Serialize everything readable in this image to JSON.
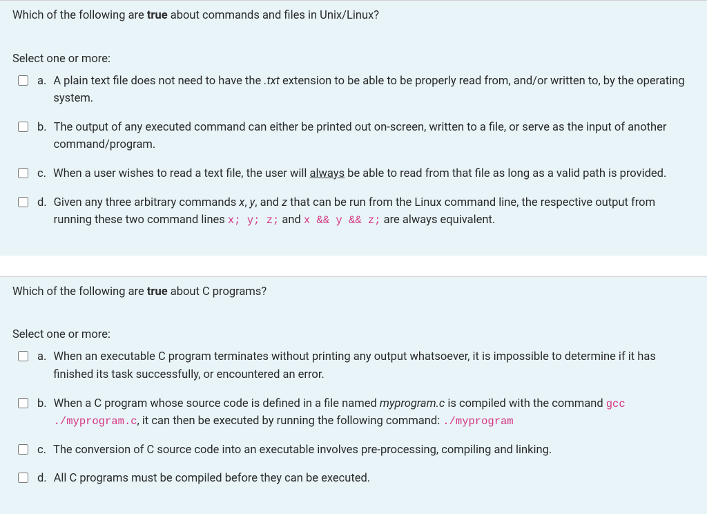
{
  "questions": [
    {
      "stem_parts": [
        {
          "t": "Which of the following are ",
          "cls": ""
        },
        {
          "t": "true",
          "cls": "strong"
        },
        {
          "t": " about commands and files in Unix/Linux?",
          "cls": ""
        }
      ],
      "select_label": "Select one or more:",
      "options": [
        {
          "letter": "a.",
          "parts": [
            {
              "t": "A plain text file does not need to have the ",
              "cls": ""
            },
            {
              "t": ".txt",
              "cls": "italic"
            },
            {
              "t": " extension to be able to be properly read from, and/or written to, by the operating system.",
              "cls": ""
            }
          ]
        },
        {
          "letter": "b.",
          "parts": [
            {
              "t": "The output of any executed command can either be printed out on-screen, written to a file, or serve as the input of another command/program.",
              "cls": ""
            }
          ]
        },
        {
          "letter": "c.",
          "parts": [
            {
              "t": "When a user wishes to read a text file, the user will ",
              "cls": ""
            },
            {
              "t": "always",
              "cls": "underline"
            },
            {
              "t": " be able to read from that file as long as a valid path is provided.",
              "cls": ""
            }
          ]
        },
        {
          "letter": "d.",
          "parts": [
            {
              "t": "Given any three arbitrary commands ",
              "cls": ""
            },
            {
              "t": "x",
              "cls": "italic"
            },
            {
              "t": ", ",
              "cls": ""
            },
            {
              "t": "y",
              "cls": "italic"
            },
            {
              "t": ", and ",
              "cls": ""
            },
            {
              "t": "z",
              "cls": "italic"
            },
            {
              "t": " that can be run from the Linux command line, the respective output from running these two command lines ",
              "cls": ""
            },
            {
              "t": "x; y; z;",
              "cls": "mono"
            },
            {
              "t": " and ",
              "cls": ""
            },
            {
              "t": "x && y && z;",
              "cls": "mono"
            },
            {
              "t": " are always equivalent.",
              "cls": ""
            }
          ]
        }
      ]
    },
    {
      "stem_parts": [
        {
          "t": "Which of the following are ",
          "cls": ""
        },
        {
          "t": "true",
          "cls": "strong"
        },
        {
          "t": " about C programs?",
          "cls": ""
        }
      ],
      "select_label": "Select one or more:",
      "options": [
        {
          "letter": "a.",
          "parts": [
            {
              "t": "When an executable C program terminates without printing any output whatsoever, it is impossible to determine if it has finished its task successfully, or encountered an error.",
              "cls": ""
            }
          ]
        },
        {
          "letter": "b.",
          "parts": [
            {
              "t": "When a C program whose source code is defined in a file named ",
              "cls": ""
            },
            {
              "t": "myprogram.c",
              "cls": "italic"
            },
            {
              "t": " is compiled with the command ",
              "cls": ""
            },
            {
              "t": "gcc ./myprogram.c",
              "cls": "mono"
            },
            {
              "t": ", it can then be executed by running the following command: ",
              "cls": ""
            },
            {
              "t": "./myprogram",
              "cls": "mono"
            }
          ]
        },
        {
          "letter": "c.",
          "parts": [
            {
              "t": "The conversion of C source code into an executable involves pre-processing, compiling and linking.",
              "cls": ""
            }
          ]
        },
        {
          "letter": "d.",
          "parts": [
            {
              "t": "All C programs must be compiled before they can be executed.",
              "cls": ""
            }
          ]
        }
      ]
    }
  ]
}
